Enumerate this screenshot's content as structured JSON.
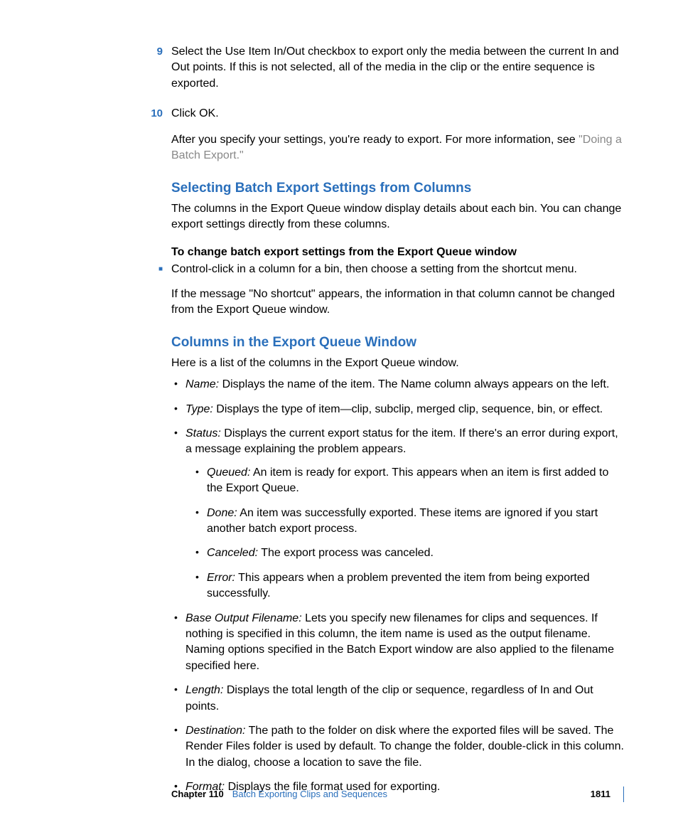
{
  "steps": [
    {
      "num": "9",
      "text": "Select the Use Item In/Out checkbox to export only the media between the current In and Out points. If this is not selected, all of the media in the clip or the entire sequence is exported."
    },
    {
      "num": "10",
      "text": "Click OK.",
      "followup_pre": "After you specify your settings, you're ready to export. For more information, see ",
      "followup_link": "\"Doing a Batch Export.\""
    }
  ],
  "section1": {
    "heading": "Selecting Batch Export Settings from Columns",
    "intro": "The columns in the Export Queue window display details about each bin. You can change export settings directly from these columns.",
    "boldline": "To change batch export settings from the Export Queue window",
    "bullet": "Control-click in a column for a bin, then choose a setting from the shortcut menu.",
    "note": "If the message \"No shortcut\" appears, the information in that column cannot be changed from the Export Queue window."
  },
  "section2": {
    "heading": "Columns in the Export Queue Window",
    "intro": "Here is a list of the columns in the Export Queue window.",
    "items": [
      {
        "term": "Name:",
        "desc": "  Displays the name of the item. The Name column always appears on the left."
      },
      {
        "term": "Type:",
        "desc": "  Displays the type of item—clip, subclip, merged clip, sequence, bin, or effect."
      },
      {
        "term": "Status:",
        "desc": "  Displays the current export status for the item. If there's an error during export, a message explaining the problem appears.",
        "sub": [
          {
            "term": "Queued:",
            "desc": "  An item is ready for export. This appears when an item is first added to the Export Queue."
          },
          {
            "term": "Done:",
            "desc": "  An item was successfully exported. These items are ignored if you start another batch export process."
          },
          {
            "term": "Canceled:",
            "desc": "  The export process was canceled."
          },
          {
            "term": "Error:",
            "desc": "  This appears when a problem prevented the item from being exported successfully."
          }
        ]
      },
      {
        "term": "Base Output Filename:",
        "desc": "  Lets you specify new filenames for clips and sequences. If nothing is specified in this column, the item name is used as the output filename. Naming options specified in the Batch Export window are also applied to the filename specified here."
      },
      {
        "term": "Length:",
        "desc": "  Displays the total length of the clip or sequence, regardless of In and Out points."
      },
      {
        "term": "Destination:",
        "desc": "  The path to the folder on disk where the exported files will be saved. The Render Files folder is used by default. To change the folder, double-click in this column. In the dialog, choose a location to save the file."
      },
      {
        "term": "Format:",
        "desc": "  Displays the file format used for exporting."
      }
    ]
  },
  "footer": {
    "chapter": "Chapter 110",
    "title": "Batch Exporting Clips and Sequences",
    "page": "1811"
  }
}
